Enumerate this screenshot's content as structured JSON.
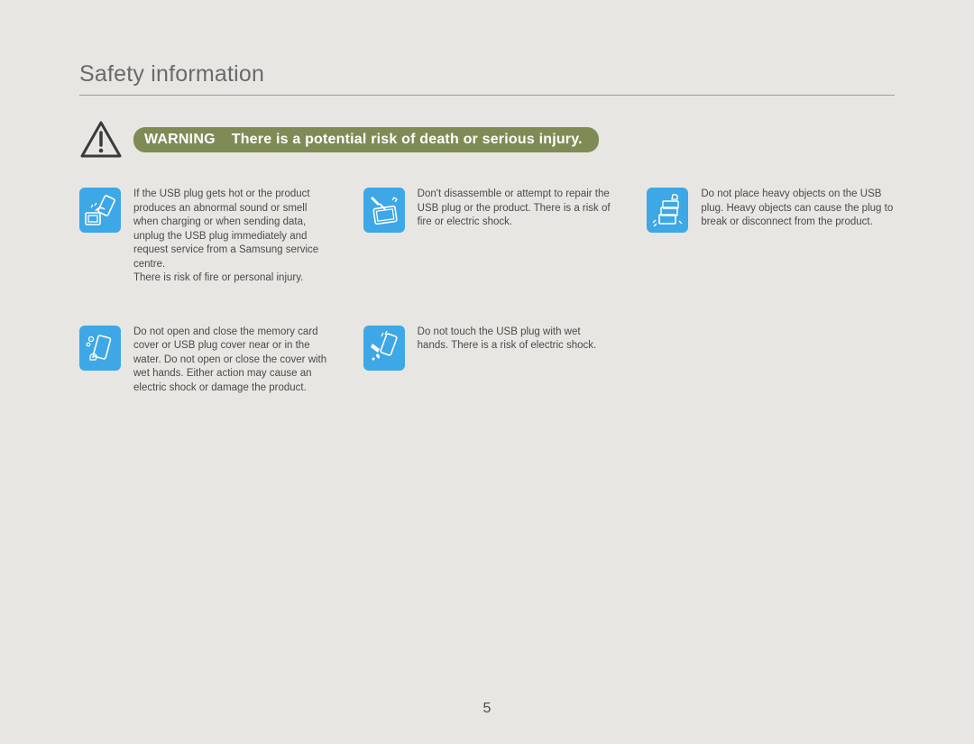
{
  "title": "Safety information",
  "warning": {
    "label": "WARNING",
    "text": "There is a potential risk of death or serious injury."
  },
  "items": [
    {
      "icon": "usb-hot-icon",
      "text": "If the USB plug gets hot or the product produces an abnormal sound or smell when charging or when sending data, unplug the USB plug immediately and request service from a Samsung service centre.\nThere is risk of fire or personal injury."
    },
    {
      "icon": "disassemble-icon",
      "text": "Don't disassemble or attempt to repair the USB plug or the product. There is a risk of fire or electric shock."
    },
    {
      "icon": "heavy-object-icon",
      "text": "Do not place heavy objects on the USB plug. Heavy objects can cause the plug to break or disconnect from the product."
    },
    {
      "icon": "water-cover-icon",
      "text": "Do not open and close the memory card cover or USB plug cover near or in the water. Do not open or close the cover with wet hands. Either action may cause an electric shock or damage the product."
    },
    {
      "icon": "wet-hands-icon",
      "text": "Do not touch the USB plug with wet hands. There is a risk of electric shock."
    }
  ],
  "page_number": "5"
}
